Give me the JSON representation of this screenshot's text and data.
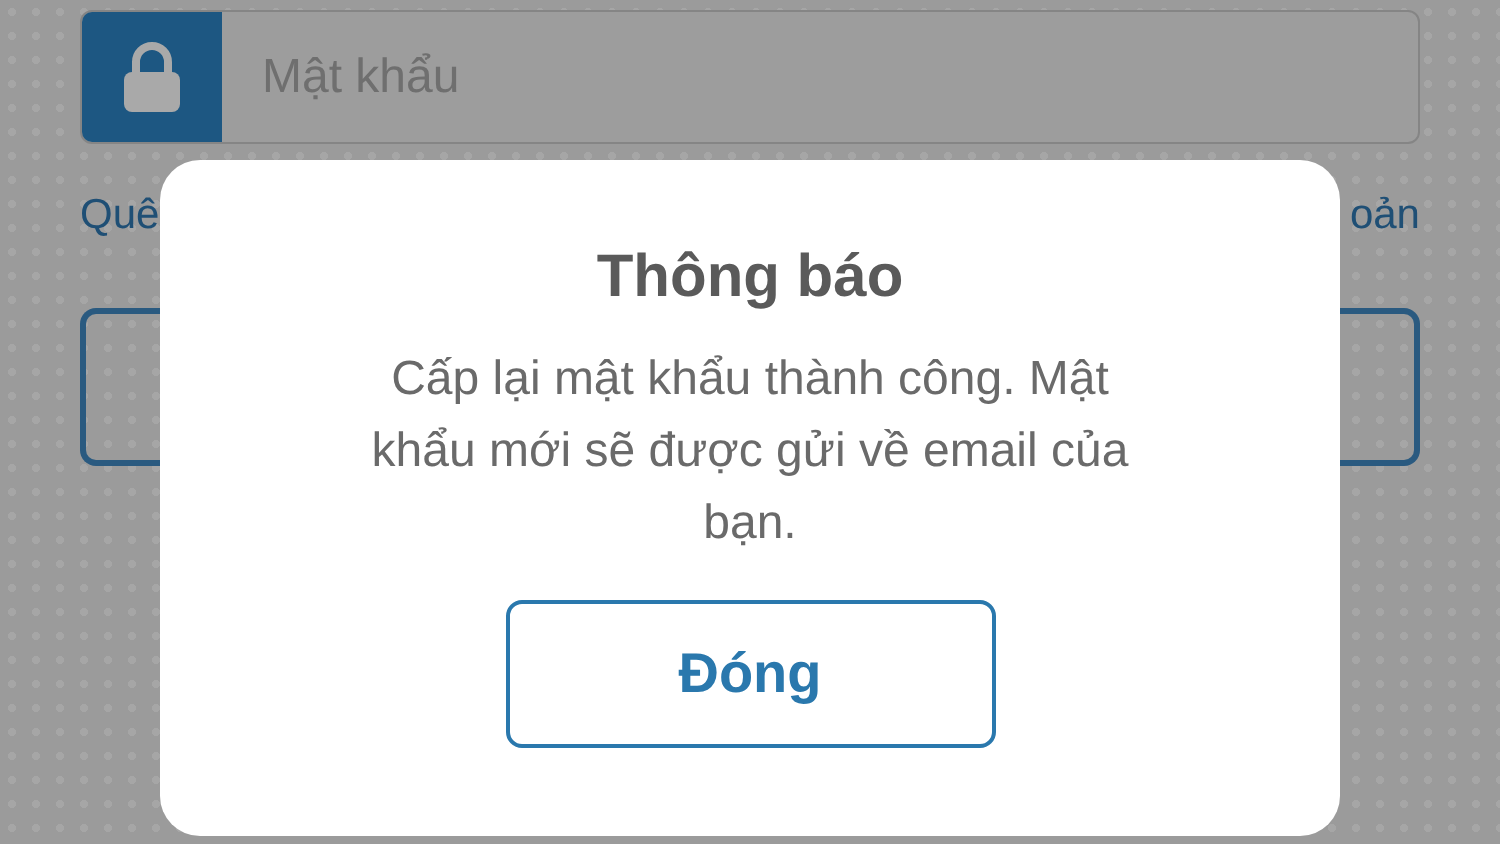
{
  "password_field": {
    "placeholder": "Mật khẩu"
  },
  "links": {
    "left": "Quê",
    "right": "oản"
  },
  "dialog": {
    "title": "Thông báo",
    "message": "Cấp lại mật khẩu thành công. Mật khẩu mới sẽ được gửi về email của bạn.",
    "button": "Đóng"
  }
}
